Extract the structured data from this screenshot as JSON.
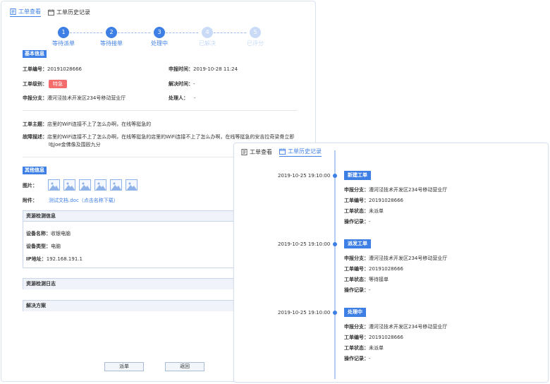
{
  "colors": {
    "accent": "#3e7fe6",
    "urgent": "#f56c6c",
    "step_pending": "#c9dbf7"
  },
  "left": {
    "tabs": [
      {
        "label": "工单查看",
        "icon": "document-icon"
      },
      {
        "label": "工单历史记录",
        "icon": "calendar-icon"
      }
    ],
    "steps": [
      {
        "num": "1",
        "label": "等待派单",
        "status": "done"
      },
      {
        "num": "2",
        "label": "等待接单",
        "status": "done"
      },
      {
        "num": "3",
        "label": "处理中",
        "status": "done"
      },
      {
        "num": "4",
        "label": "已解决",
        "status": "pending"
      },
      {
        "num": "5",
        "label": "已评分",
        "status": "pending"
      }
    ],
    "basic": {
      "title": "基本信息",
      "order_no_label": "工单编号：",
      "order_no": "20191028666",
      "report_time_label": "申报时间：",
      "report_time": "2019-10-28 11:24",
      "level_label": "工单级别：",
      "level": "特急",
      "resolve_time_label": "解决时间：",
      "resolve_time": "-",
      "branch_label": "申报分支：",
      "branch": "漕河泾技术开发区234号移动营业厅",
      "handler_label": "处理人：",
      "handler": "-"
    },
    "subject_label": "工单主题：",
    "subject": "店里的WiFi连接不上了怎么办啊，在线等挺急的",
    "fault_label": "故障描述：",
    "fault_line1": "店里的WiFi连接不上了怎么办啊，在线等挺急的店里的WiFi连接不上了怎么办啊，在线等挺急的安吉拉奇梁骨立即",
    "fault_line2": "咕Joe金佛像及围殴九分",
    "other": {
      "title": "其他信息",
      "pics_label": "图片：",
      "attach_label": "附件：",
      "attach_file": "测试文档.doc（点击名称下载）"
    },
    "asset": {
      "title": "资源检测信息",
      "device_name_label": "设备名称：",
      "device_name": "收银电脑",
      "device_type_label": "设备类型：",
      "device_type": "电脑",
      "ip_label": "IP地址：",
      "ip": "192.168.191.1"
    },
    "asset_log_title": "资源检测日志",
    "solution_title": "解决方案",
    "buttons": {
      "dispatch": "派单",
      "back": "返回"
    }
  },
  "right": {
    "tabs": [
      {
        "label": "工单查看",
        "icon": "document-icon"
      },
      {
        "label": "工单历史记录",
        "icon": "calendar-icon"
      }
    ],
    "labels": {
      "branch": "申报分支：",
      "order_no": "工单编号：",
      "status": "工单状态：",
      "ops": "操作记录："
    },
    "history": [
      {
        "time": "2019-10-25 19:10:00",
        "tag": "新建工单",
        "branch": "漕河泾技术开发区234号移动营业厅",
        "order_no": "20191028666",
        "status": "未派单",
        "ops": "-"
      },
      {
        "time": "2019-10-25 19:10:00",
        "tag": "派发工单",
        "branch": "漕河泾技术开发区234号移动营业厅",
        "order_no": "20191028666",
        "status": "等待接单",
        "ops": "-"
      },
      {
        "time": "2019-10-25 19:10:00",
        "tag": "处理中",
        "branch": "漕河泾技术开发区234号移动营业厅",
        "order_no": "20191028666",
        "status": "未派单",
        "ops": "-"
      }
    ]
  }
}
